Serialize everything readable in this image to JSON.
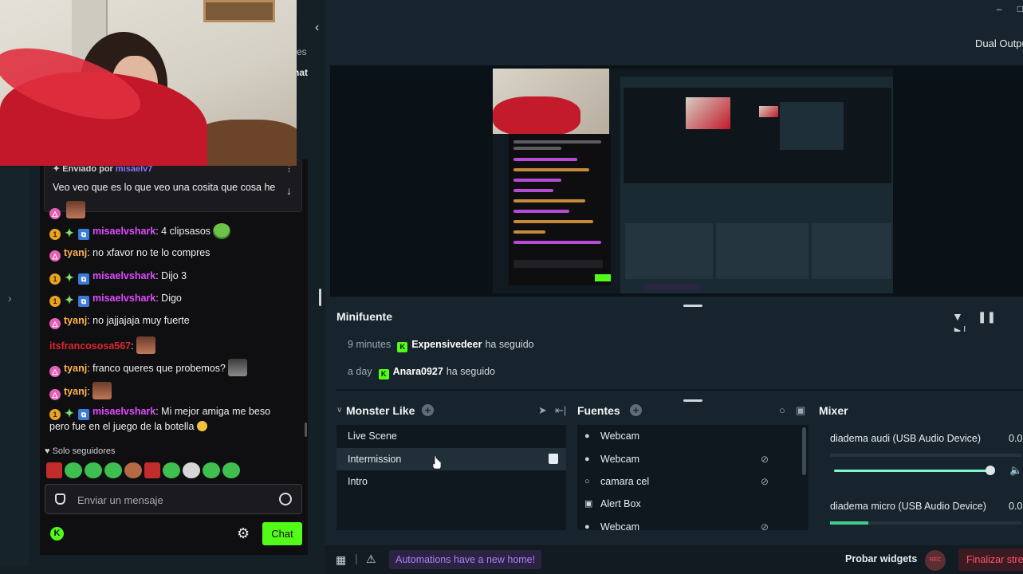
{
  "chat": {
    "pinned": {
      "title_prefix": "Enviado por",
      "title_user": "misaelv7",
      "body": "Veo veo que es lo que veo una cosita que cosa he"
    },
    "messages": [
      {
        "user": "misaelvshark",
        "text": ": 4 clipsasos",
        "color": "#e04bff"
      },
      {
        "user": "tyanj",
        "text": ": no xfavor no te lo compres",
        "color": "#ffb34a"
      },
      {
        "user": "misaelvshark",
        "text": ": Dijo 3",
        "color": "#e04bff"
      },
      {
        "user": "misaelvshark",
        "text": ": Digo",
        "color": "#e04bff"
      },
      {
        "user": "tyanj",
        "text": ": no jajjajaja muy fuerte",
        "color": "#ffb34a"
      },
      {
        "user": "itsfrancososa567",
        "text": ":",
        "color": "#e0242f"
      },
      {
        "user": "tyanj",
        "text": ": franco queres que probemos?",
        "color": "#ffb34a"
      },
      {
        "user": "tyanj",
        "text": ":",
        "color": "#ffb34a"
      },
      {
        "user": "misaelvshark",
        "text": ": Mi mejor amiga me beso",
        "color": "#e04bff"
      },
      {
        "user": "",
        "text": "pero fue en el juego de la botella",
        "color": "#efefef"
      }
    ],
    "solo_seguidores": "Solo seguidores",
    "input_placeholder": "Enviar un mensaje",
    "chat_button": "Chat",
    "truncated_1": "res",
    "truncated_2": "hat"
  },
  "editor": {
    "dual_output": "Dual Output",
    "minifuente": {
      "title": "Minifuente",
      "events": [
        {
          "time": "9 minutes",
          "user": "Expensivedeer",
          "action": "ha seguido"
        },
        {
          "time": "a day",
          "user": "Anara0927",
          "action": "ha seguido"
        }
      ]
    },
    "scenes": {
      "title": "Monster Like",
      "items": [
        "Live Scene",
        "Intermission",
        "Intro"
      ],
      "selected": "Intermission"
    },
    "sources": {
      "title": "Fuentes",
      "items": [
        {
          "label": "Webcam",
          "icon": "user-icon"
        },
        {
          "label": "Webcam",
          "icon": "user-icon"
        },
        {
          "label": "camara cel",
          "icon": "globe-icon"
        },
        {
          "label": "Alert Box",
          "icon": "alert-box-icon"
        },
        {
          "label": "Webcam",
          "icon": "user-icon"
        }
      ]
    },
    "mixer": {
      "title": "Mixer",
      "items": [
        {
          "label": "diadema audi (USB Audio Device)",
          "value": "0.0",
          "volume": 0.98
        },
        {
          "label": "diadema micro (USB Audio Device)",
          "value": "0.0",
          "level": 0.2
        }
      ]
    },
    "footer": {
      "automations": "Automations have a new home!",
      "probar_widgets": "Probar widgets",
      "rec": "REC",
      "finalizar": "Finalizar stream"
    }
  },
  "colors": {
    "kick_green": "#53fc18",
    "accent_purple": "#b07cff",
    "editor_bg": "#17242d"
  }
}
